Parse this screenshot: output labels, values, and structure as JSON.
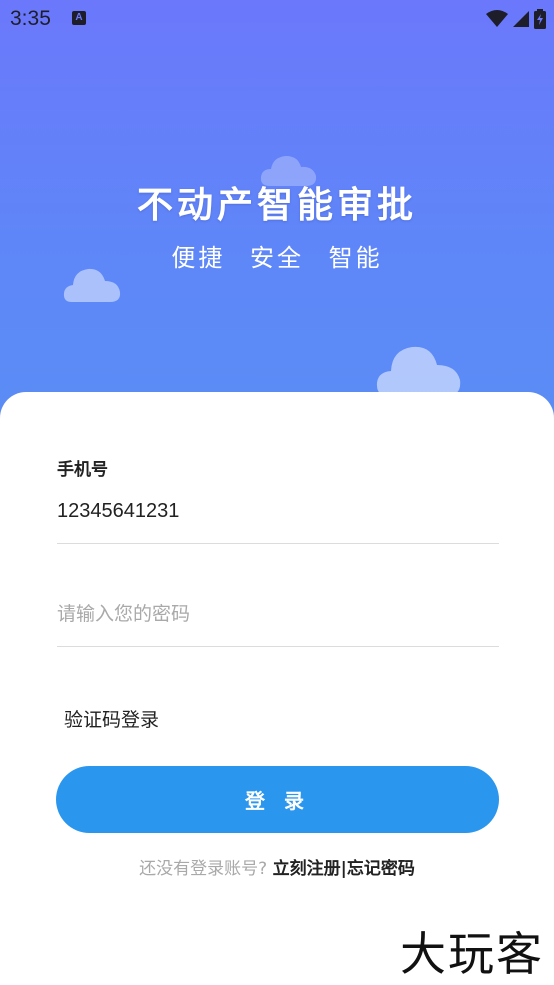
{
  "status_bar": {
    "time": "3:35",
    "notification_glyph": "A",
    "icons": [
      "wifi-icon",
      "signal-icon",
      "battery-icon"
    ]
  },
  "hero": {
    "title": "不动产智能审批",
    "subtitle": "便捷 安全 智能"
  },
  "form": {
    "phone_label": "手机号",
    "phone_value": "12345641231",
    "password_placeholder": "请输入您的密码",
    "sms_login_label": "验证码登录",
    "login_button_label": "登 录"
  },
  "footer": {
    "question": "还没有登录账号?",
    "register_link": "立刻注册",
    "separator": "|",
    "forgot_link": "忘记密码"
  },
  "watermark": "大玩客",
  "colors": {
    "gradient_top": "#6b78fb",
    "gradient_bottom": "#5a8df6",
    "primary_button": "#2b96ee"
  }
}
